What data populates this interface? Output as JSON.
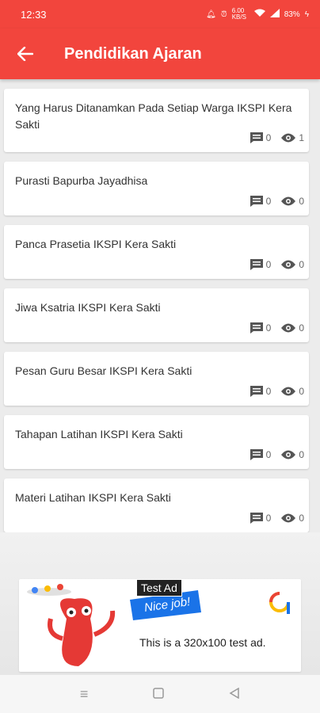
{
  "status": {
    "time": "12:33",
    "speed": "6.00 KB/S",
    "battery": "83%"
  },
  "appbar": {
    "title": "Pendidikan Ajaran"
  },
  "items": [
    {
      "title": "Yang Harus Ditanamkan Pada Setiap Warga IKSPI Kera Sakti",
      "comments": "0",
      "views": "1"
    },
    {
      "title": "Purasti Bapurba Jayadhisa",
      "comments": "0",
      "views": "0"
    },
    {
      "title": "Panca Prasetia IKSPI Kera Sakti",
      "comments": "0",
      "views": "0"
    },
    {
      "title": "Jiwa Ksatria IKSPI Kera Sakti",
      "comments": "0",
      "views": "0"
    },
    {
      "title": "Pesan Guru Besar IKSPI Kera Sakti",
      "comments": "0",
      "views": "0"
    },
    {
      "title": "Tahapan Latihan IKSPI Kera Sakti",
      "comments": "0",
      "views": "0"
    },
    {
      "title": "Materi Latihan IKSPI Kera Sakti",
      "comments": "0",
      "views": "0"
    }
  ],
  "ad": {
    "label": "Test Ad",
    "banner": "Nice job!",
    "text": "This is a 320x100 test ad."
  },
  "colors": {
    "primary": "#f2453d"
  }
}
